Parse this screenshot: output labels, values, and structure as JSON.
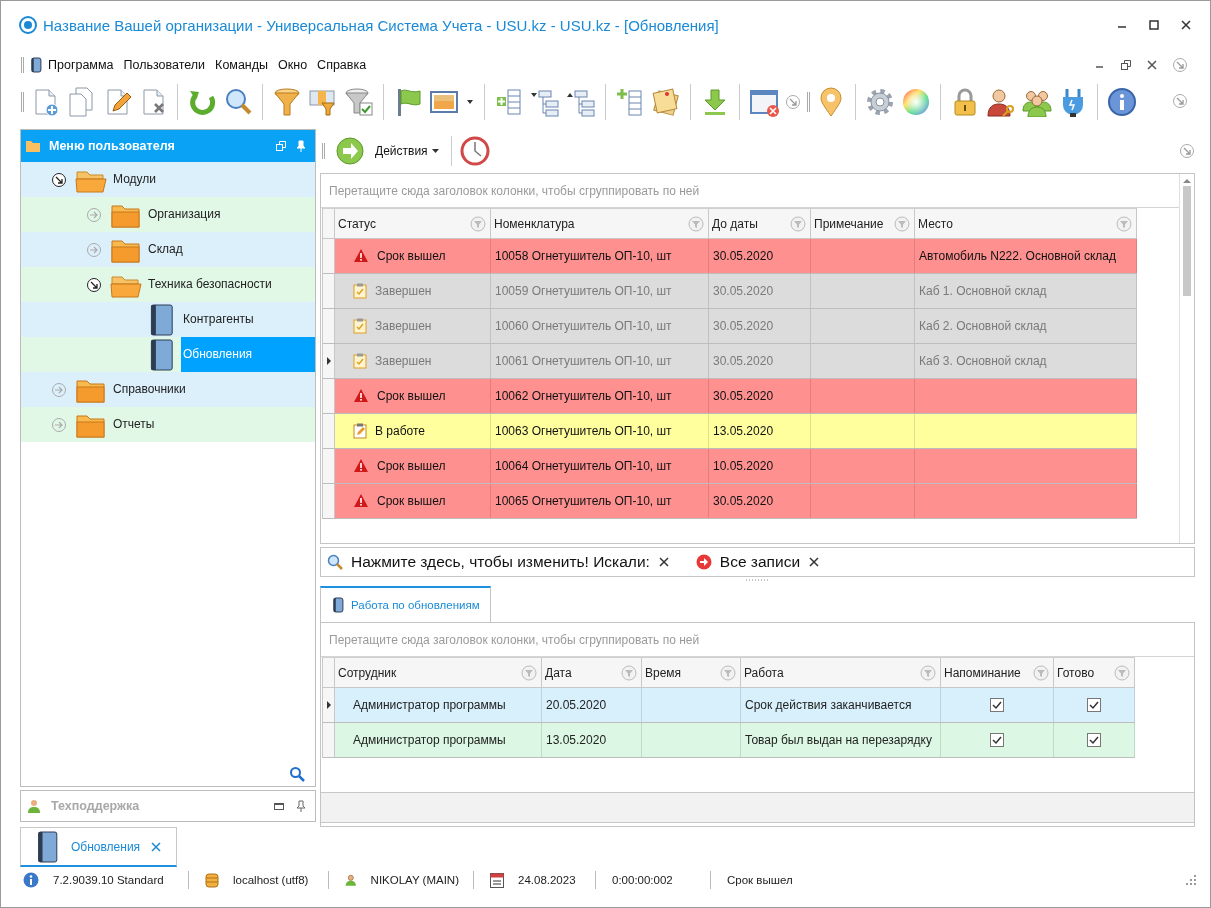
{
  "window": {
    "title": "Название Вашей организации - Универсальная Система Учета - USU.kz - USU.kz - [Обновления]"
  },
  "menu": [
    "Программа",
    "Пользователи",
    "Команды",
    "Окно",
    "Справка"
  ],
  "user_menu": {
    "title": "Меню пользователя",
    "tree": [
      {
        "label": "Модули",
        "kind": "folder",
        "expanded": true,
        "selected": false,
        "children": [
          {
            "label": "Организация",
            "kind": "folder",
            "expanded": false,
            "selected": false
          },
          {
            "label": "Склад",
            "kind": "folder",
            "expanded": false,
            "selected": false
          },
          {
            "label": "Техника безопасности",
            "kind": "folder",
            "expanded": true,
            "selected": false,
            "children": [
              {
                "label": "Контрагенты",
                "kind": "document",
                "selected": false
              },
              {
                "label": "Обновления",
                "kind": "document",
                "selected": true
              }
            ]
          }
        ]
      },
      {
        "label": "Справочники",
        "kind": "folder",
        "expanded": false,
        "selected": false
      },
      {
        "label": "Отчеты",
        "kind": "folder",
        "expanded": false,
        "selected": false
      }
    ]
  },
  "support_panel": {
    "title": "Техподдержка"
  },
  "actions": {
    "label": "Действия"
  },
  "main_grid": {
    "group_hint": "Перетащите сюда заголовок колонки, чтобы сгруппировать по ней",
    "columns": [
      "Статус",
      "Номенклатура",
      "До даты",
      "Примечание",
      "Место"
    ],
    "rows": [
      {
        "kind": "expired",
        "focused": false,
        "status": "Срок вышел",
        "item": "10058 Огнетушитель ОП-10, шт",
        "due_date": "30.05.2020",
        "place": "Автомобиль N222. Основной склад"
      },
      {
        "kind": "done",
        "focused": false,
        "status": "Завершен",
        "item": "10059 Огнетушитель ОП-10, шт",
        "due_date": "30.05.2020",
        "place": "Каб 1. Основной склад"
      },
      {
        "kind": "done",
        "focused": false,
        "status": "Завершен",
        "item": "10060 Огнетушитель ОП-10, шт",
        "due_date": "30.05.2020",
        "place": "Каб 2. Основной склад"
      },
      {
        "kind": "done",
        "focused": true,
        "status": "Завершен",
        "item": "10061 Огнетушитель ОП-10, шт",
        "due_date": "30.05.2020",
        "place": "Каб 3. Основной склад"
      },
      {
        "kind": "expired",
        "focused": false,
        "status": "Срок вышел",
        "item": "10062 Огнетушитель ОП-10, шт",
        "due_date": "30.05.2020"
      },
      {
        "kind": "in_work",
        "focused": false,
        "status": "В работе",
        "item": "10063 Огнетушитель ОП-10, шт",
        "due_date": "13.05.2020"
      },
      {
        "kind": "expired",
        "focused": false,
        "status": "Срок вышел",
        "item": "10064 Огнетушитель ОП-10, шт",
        "due_date": "10.05.2020"
      },
      {
        "kind": "expired",
        "focused": false,
        "status": "Срок вышел",
        "item": "10065 Огнетушитель ОП-10, шт",
        "due_date": "30.05.2020"
      }
    ]
  },
  "filter_bar": {
    "prefix": "Нажмите здесь, чтобы изменить! Искали:",
    "filter": "Все записи"
  },
  "detail_tab": {
    "label": "Работа по обновлениям",
    "selected": true
  },
  "detail_grid": {
    "group_hint": "Перетащите сюда заголовок колонки, чтобы сгруппировать по ней",
    "columns": [
      "Сотрудник",
      "Дата",
      "Время",
      "Работа",
      "Напоминание",
      "Готово"
    ],
    "rows": [
      {
        "focused": true,
        "employee": "Администратор программы",
        "date": "20.05.2020",
        "work": "Срок действия заканчивается",
        "reminder": true,
        "done": true
      },
      {
        "focused": false,
        "employee": "Администратор программы",
        "date": "13.05.2020",
        "work": "Товар был выдан на перезарядку",
        "reminder": true,
        "done": true
      }
    ]
  },
  "doc_tabs": [
    {
      "label": "Обновления",
      "selected": true
    }
  ],
  "status_bar": [
    {
      "kind": "version",
      "text": "7.2.9039.10 Standard"
    },
    {
      "kind": "database",
      "text": "localhost (utf8)"
    },
    {
      "kind": "user",
      "text": "NIKOLAY (MAIN)"
    },
    {
      "kind": "date",
      "text": "24.08.2023"
    },
    {
      "kind": "timer",
      "text": "0:00:00:002"
    },
    {
      "kind": "message",
      "text": "Срок вышел"
    }
  ]
}
